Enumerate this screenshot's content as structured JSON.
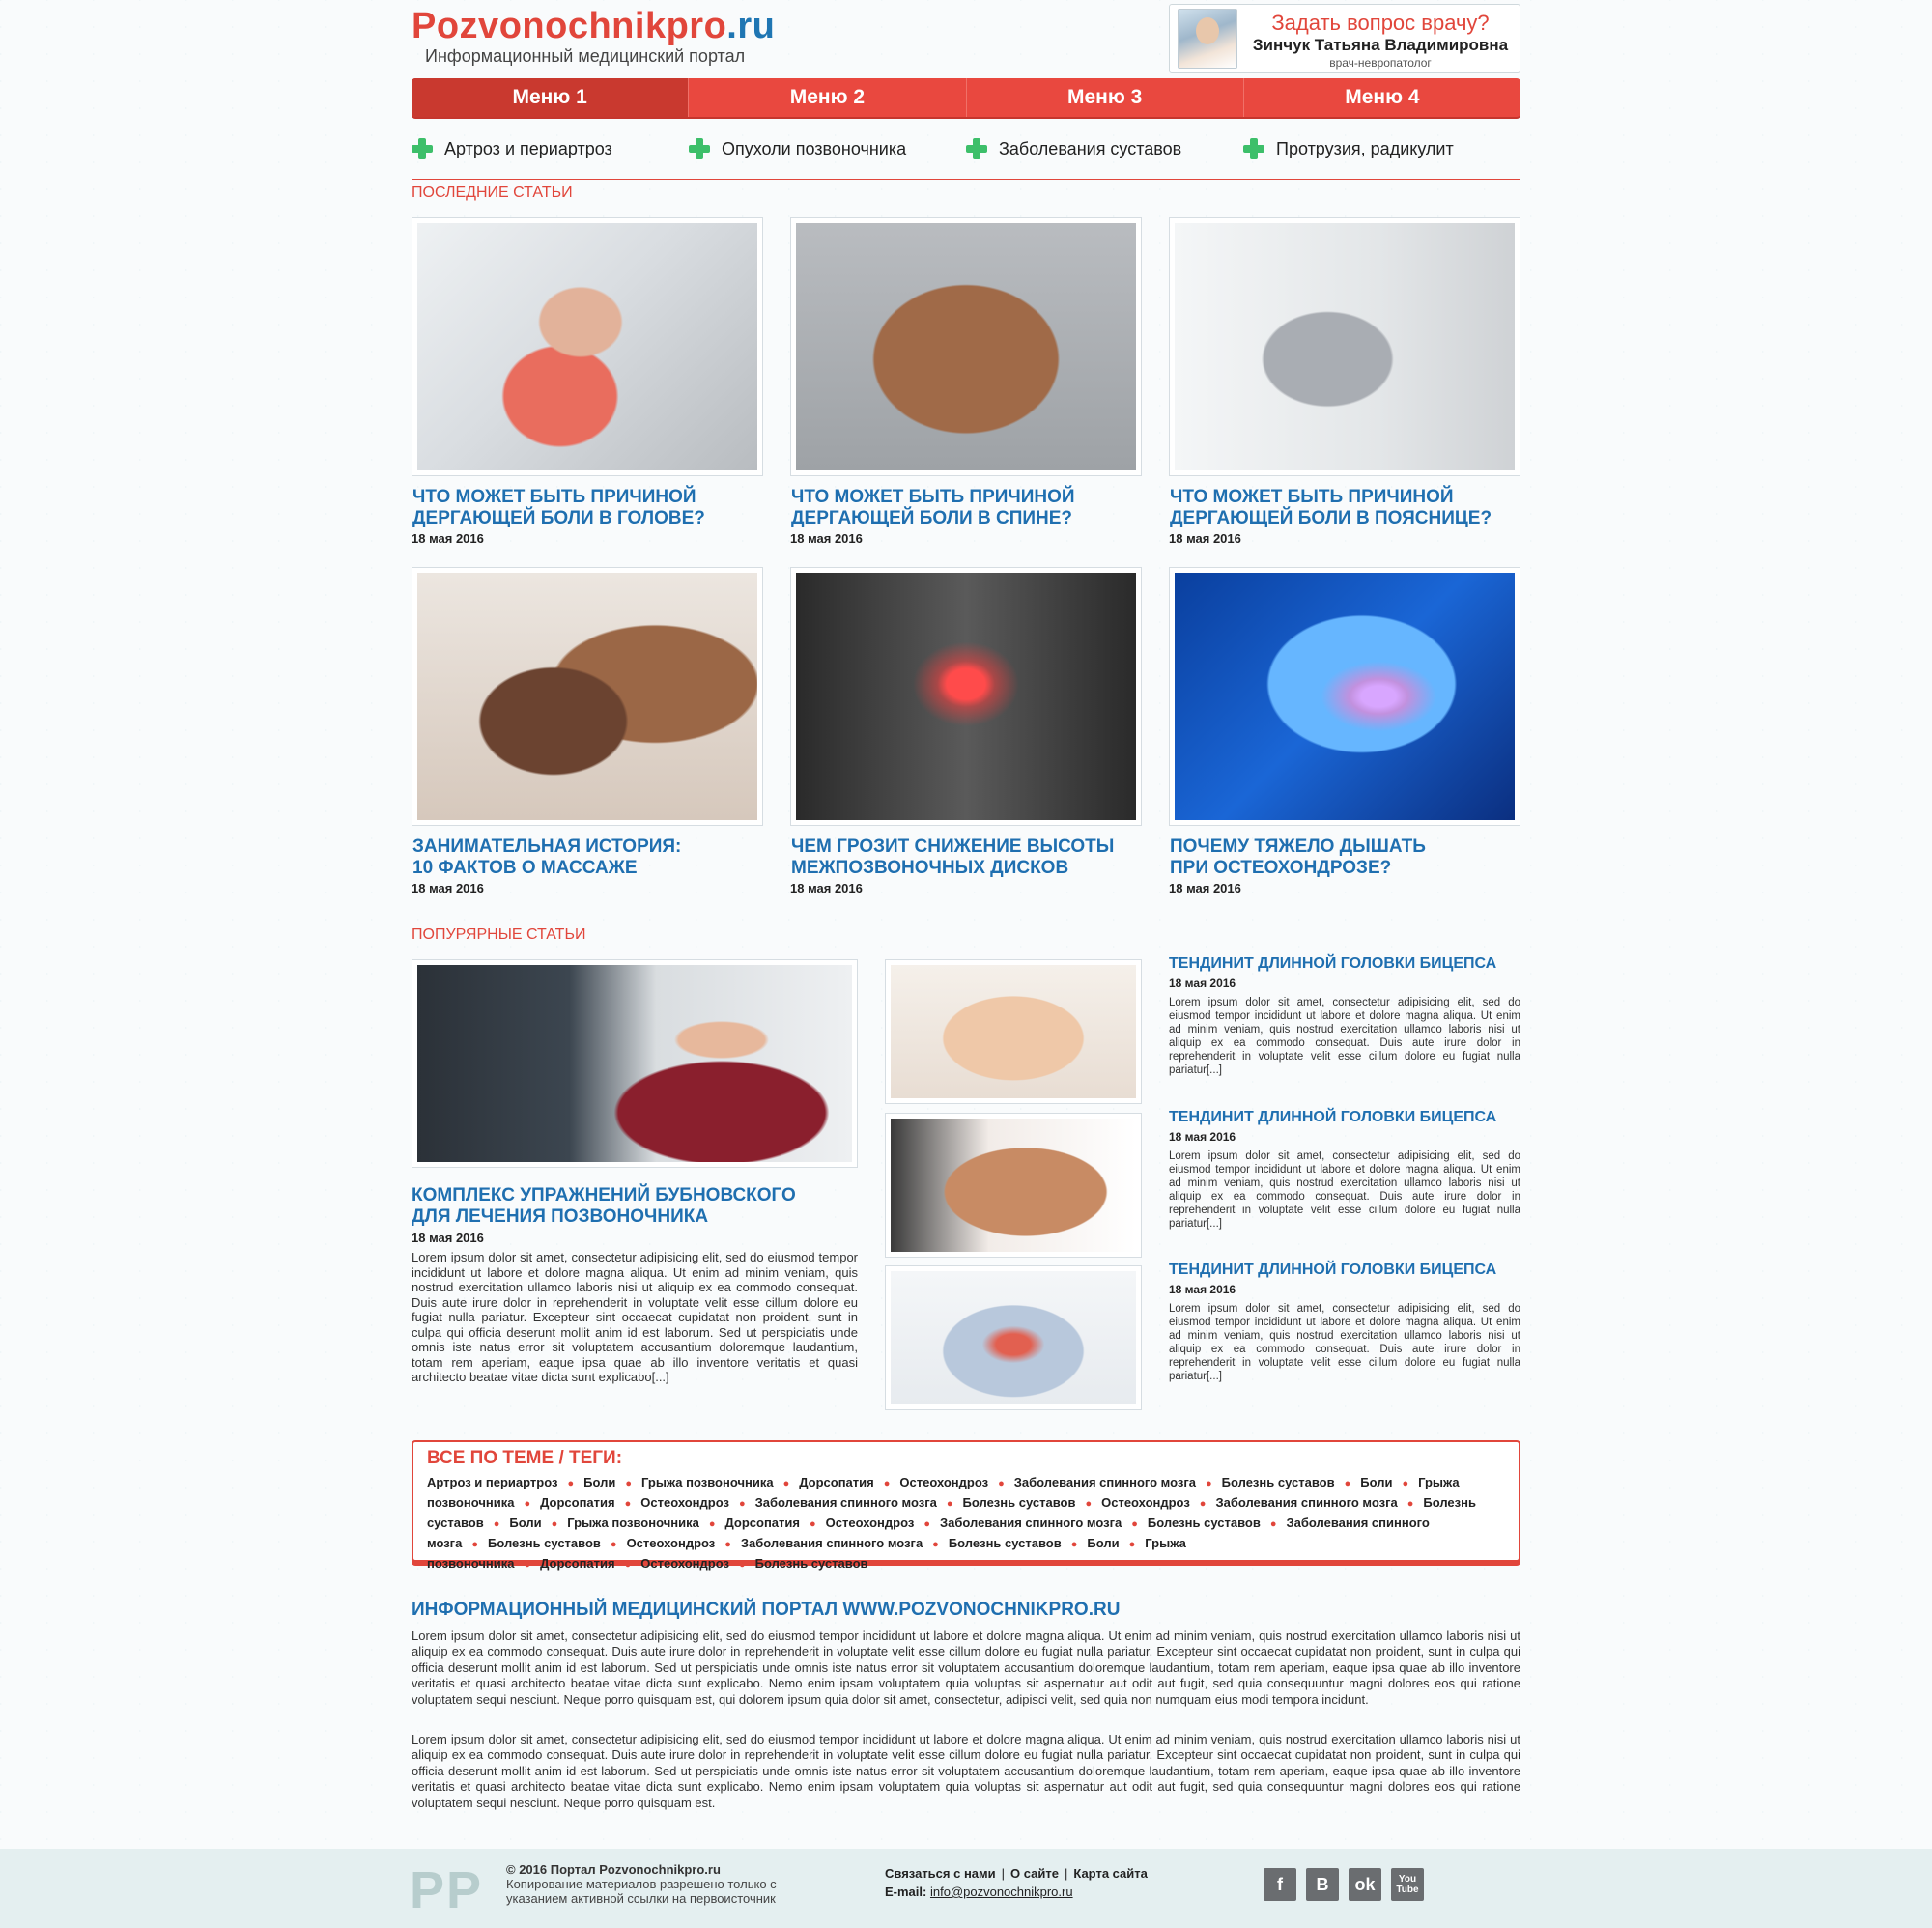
{
  "header": {
    "logo_main": "Pozvonochnikpro",
    "logo_tld": ".ru",
    "tagline": "Информационный медицинский портал",
    "ask": {
      "title": "Задать вопрос врачу?",
      "name": "Зинчук Татьяна Владимировна",
      "role": "врач-невропатолог"
    }
  },
  "menu": [
    "Меню 1",
    "Меню 2",
    "Меню 3",
    "Меню 4"
  ],
  "categories": [
    "Артроз и периартроз",
    "Опухоли позвоночника",
    "Заболевания суставов",
    "Протрузия, радикулит"
  ],
  "latest": {
    "title": "Последние статьи",
    "articles": [
      {
        "title": "Что может быть причиной\nдергающей боли в голове?",
        "date": "18 мая 2016"
      },
      {
        "title": "Что может быть причиной\nдергающей боли в спине?",
        "date": "18 мая 2016"
      },
      {
        "title": "Что может быть причиной\nдергающей боли в пояснице?",
        "date": "18 мая 2016"
      },
      {
        "title": "Занимательная история:\n10 фактов о массаже",
        "date": "18 мая 2016"
      },
      {
        "title": "Чем грозит снижение высоты\nмежпозвоночных дисков",
        "date": "18 мая 2016"
      },
      {
        "title": "Почему тяжело дышать\nпри остеохондрозе?",
        "date": "18 мая 2016"
      }
    ]
  },
  "popular": {
    "title": "Попурярные статьи",
    "main": {
      "title": "Комплекс упражнений Бубновского\nдля лечения позвоночника",
      "date": "18 мая 2016",
      "text": "Lorem ipsum dolor sit amet, consectetur adipisicing elit, sed do eiusmod tempor incididunt ut labore et dolore magna aliqua. Ut enim ad minim veniam, quis nostrud exercitation ullamco laboris nisi ut aliquip ex ea commodo consequat. Duis aute irure dolor in reprehenderit in voluptate velit esse cillum dolore eu fugiat nulla pariatur. Excepteur sint occaecat cupidatat non proident, sunt in culpa qui officia deserunt mollit anim id est laborum. Sed ut perspiciatis unde omnis iste natus error sit voluptatem accusantium doloremque laudantium, totam rem aperiam, eaque ipsa quae ab illo inventore veritatis et quasi architecto beatae vitae dicta sunt explicabo[...]"
    },
    "items": [
      {
        "title": "Тендинит длинной головки бицепса",
        "date": "18 мая 2016",
        "text": "Lorem ipsum dolor sit amet, consectetur adipisicing elit, sed do eiusmod tempor incididunt ut labore et dolore magna aliqua. Ut enim ad minim veniam, quis nostrud exercitation ullamco laboris nisi ut aliquip ex ea commodo consequat. Duis aute irure dolor in reprehenderit in voluptate velit esse cillum dolore eu fugiat nulla pariatur[...]"
      },
      {
        "title": "Тендинит длинной головки бицепса",
        "date": "18 мая 2016",
        "text": "Lorem ipsum dolor sit amet, consectetur adipisicing elit, sed do eiusmod tempor incididunt ut labore et dolore magna aliqua. Ut enim ad minim veniam, quis nostrud exercitation ullamco laboris nisi ut aliquip ex ea commodo consequat. Duis aute irure dolor in reprehenderit in voluptate velit esse cillum dolore eu fugiat nulla pariatur[...]"
      },
      {
        "title": "Тендинит длинной головки бицепса",
        "date": "18 мая 2016",
        "text": "Lorem ipsum dolor sit amet, consectetur adipisicing elit, sed do eiusmod tempor incididunt ut labore et dolore magna aliqua. Ut enim ad minim veniam, quis nostrud exercitation ullamco laboris nisi ut aliquip ex ea commodo consequat. Duis aute irure dolor in reprehenderit in voluptate velit esse cillum dolore eu fugiat nulla pariatur[...]"
      }
    ]
  },
  "tags": {
    "title": "Все по теме / теги:",
    "list": [
      "Артроз и периартроз",
      "Боли",
      "Грыжа позвоночника",
      "Дорсопатия",
      "Остеохондроз",
      "Заболевания спинного мозга",
      "Болезнь суставов",
      "Боли",
      "Грыжа позвоночника",
      "Дорсопатия",
      "Остеохондроз",
      "Заболевания спинного мозга",
      "Болезнь суставов",
      "Остеохондроз",
      "Заболевания спинного мозга",
      "Болезнь суставов",
      "Боли",
      "Грыжа позвоночника",
      "Дорсопатия",
      "Остеохондроз",
      "Заболевания спинного мозга",
      "Болезнь суставов",
      "Заболевания спинного мозга",
      "Болезнь суставов",
      "Остеохондроз",
      "Заболевания спинного мозга",
      "Болезнь суставов",
      "Боли",
      "Грыжа позвоночника",
      "Дорсопатия",
      "Остеохондроз",
      "Болезнь суставов"
    ]
  },
  "seo": {
    "title": "Информационный медицинский портал www.pozvonochnikpro.ru",
    "p1": "Lorem ipsum dolor sit amet, consectetur adipisicing elit, sed do eiusmod tempor incididunt ut labore et dolore magna aliqua. Ut enim ad minim veniam, quis nostrud exercitation ullamco laboris nisi ut aliquip ex ea commodo consequat. Duis aute irure dolor in reprehenderit in voluptate velit esse cillum dolore eu fugiat nulla pariatur. Excepteur sint occaecat cupidatat non proident, sunt in culpa qui officia deserunt mollit anim id est laborum. Sed ut perspiciatis unde omnis iste natus error sit voluptatem accusantium doloremque laudantium, totam rem aperiam, eaque ipsa quae ab illo inventore veritatis et quasi architecto beatae vitae dicta sunt explicabo. Nemo enim ipsam voluptatem quia voluptas sit aspernatur aut odit aut fugit, sed quia consequuntur magni dolores eos qui ratione voluptatem sequi nesciunt. Neque porro quisquam est, qui dolorem ipsum quia dolor sit amet, consectetur, adipisci velit, sed quia non numquam eius modi tempora incidunt.",
    "p2": "Lorem ipsum dolor sit amet, consectetur adipisicing elit, sed do eiusmod tempor incididunt ut labore et dolore magna aliqua. Ut enim ad minim veniam, quis nostrud exercitation ullamco laboris nisi ut aliquip ex ea commodo consequat. Duis aute irure dolor in reprehenderit in voluptate velit esse cillum dolore eu fugiat nulla pariatur. Excepteur sint occaecat cupidatat non proident, sunt in culpa qui officia deserunt mollit anim id est laborum. Sed ut perspiciatis unde omnis iste natus error sit voluptatem accusantium doloremque laudantium, totam rem aperiam, eaque ipsa quae ab illo inventore veritatis et quasi architecto beatae vitae dicta sunt explicabo. Nemo enim ipsam voluptatem quia voluptas sit aspernatur aut odit aut fugit, sed quia consequuntur magni dolores eos qui ratione voluptatem sequi nesciunt. Neque porro quisquam est."
  },
  "footer": {
    "logo": "PP",
    "copyright": "© 2016 Портал Pozvonochnikpro.ru",
    "notice_1": "Копирование материалов разрешено только с",
    "notice_2": "указанием активной ссылки на первоисточник",
    "links": [
      "Связаться с нами",
      "О сайте",
      "Карта сайта"
    ],
    "email_label": "E-mail:",
    "email": "info@pozvonochnikpro.ru",
    "social": [
      {
        "icon": "facebook-icon",
        "label": "f"
      },
      {
        "icon": "vkontakte-icon",
        "label": "B"
      },
      {
        "icon": "odnoklassniki-icon",
        "label": "ok"
      },
      {
        "icon": "youtube-icon",
        "label": "You Tube"
      }
    ]
  },
  "colors": {
    "accent_red": "#e1463b",
    "link_blue": "#1f6fb0",
    "plus_green": "#3dbf6a"
  }
}
